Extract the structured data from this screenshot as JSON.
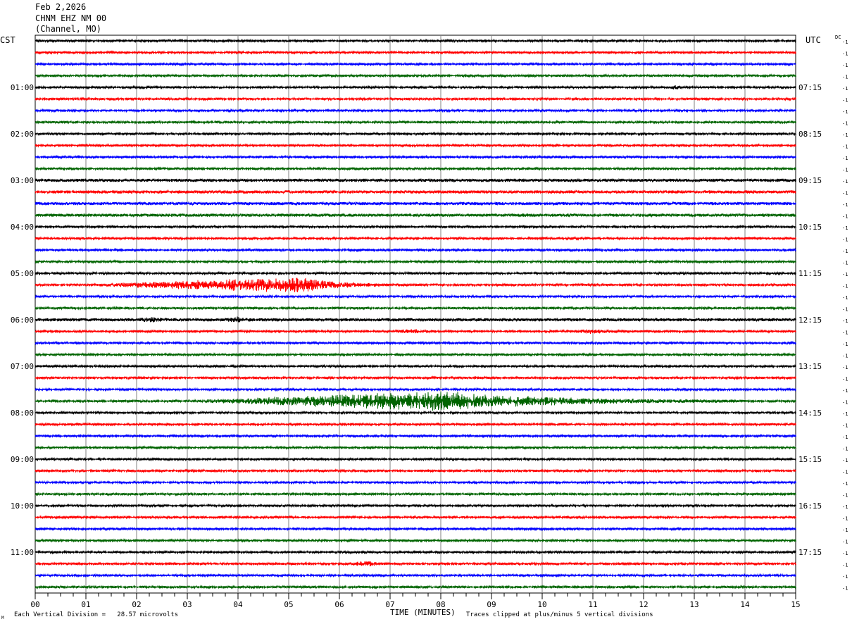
{
  "header": {
    "date": "Feb 2,2026",
    "station": "CHNM EHZ NM 00",
    "channel_note": "(Channel, MO)"
  },
  "left_tz": "CST",
  "right_tz": "UTC",
  "dc_label": "DC",
  "trace_offset_label": "-1",
  "footer": {
    "vertical_division": "Each Vertical Division =   28.57 microvolts",
    "x_title": "TIME (MINUTES)",
    "clip_note": "Traces clipped at plus/minus 5 vertical divisions",
    "corner_mark": "M"
  },
  "colors": {
    "black": "#000000",
    "red": "#ff0000",
    "blue": "#0000ff",
    "green": "#006400",
    "grid": "#808080"
  },
  "chart_data": {
    "type": "helicorder",
    "x_axis": {
      "label": "TIME (MINUTES)",
      "range": [
        0,
        15
      ],
      "ticks": [
        "00",
        "01",
        "02",
        "03",
        "04",
        "05",
        "06",
        "07",
        "08",
        "09",
        "10",
        "11",
        "12",
        "13",
        "14",
        "15"
      ]
    },
    "rows_per_hour": 4,
    "minutes_per_row": 15,
    "row_count": 48,
    "row_color_cycle": [
      "black",
      "red",
      "blue",
      "green"
    ],
    "left_hour_labels": [
      {
        "row": 4,
        "text": "01:00"
      },
      {
        "row": 8,
        "text": "02:00"
      },
      {
        "row": 12,
        "text": "03:00"
      },
      {
        "row": 16,
        "text": "04:00"
      },
      {
        "row": 20,
        "text": "05:00"
      },
      {
        "row": 24,
        "text": "06:00"
      },
      {
        "row": 28,
        "text": "07:00"
      },
      {
        "row": 32,
        "text": "08:00"
      },
      {
        "row": 36,
        "text": "09:00"
      },
      {
        "row": 40,
        "text": "10:00"
      },
      {
        "row": 44,
        "text": "11:00"
      }
    ],
    "right_hour_labels": [
      {
        "row": 4,
        "text": "07:15"
      },
      {
        "row": 8,
        "text": "08:15"
      },
      {
        "row": 12,
        "text": "09:15"
      },
      {
        "row": 16,
        "text": "10:15"
      },
      {
        "row": 20,
        "text": "11:15"
      },
      {
        "row": 24,
        "text": "12:15"
      },
      {
        "row": 28,
        "text": "13:15"
      },
      {
        "row": 32,
        "text": "14:15"
      },
      {
        "row": 36,
        "text": "15:15"
      },
      {
        "row": 40,
        "text": "16:15"
      },
      {
        "row": 44,
        "text": "17:15"
      }
    ],
    "noise_level": 1.5,
    "busy_rows": [
      12,
      13,
      14,
      15,
      24
    ],
    "events": [
      {
        "row": 21,
        "start_min": 1.0,
        "peak_min": 5.3,
        "end_min": 7.2,
        "amplitude": 11
      },
      {
        "row": 31,
        "start_min": 3.0,
        "peak_min": 8.0,
        "end_min": 14.0,
        "amplitude": 14
      },
      {
        "row": 45,
        "start_min": 6.0,
        "peak_min": 6.6,
        "end_min": 7.0,
        "amplitude": 3
      },
      {
        "row": 25,
        "start_min": 7.0,
        "peak_min": 7.5,
        "end_min": 8.0,
        "amplitude": 2.5
      },
      {
        "row": 25,
        "start_min": 10.6,
        "peak_min": 10.9,
        "end_min": 12.0,
        "amplitude": 2.5
      },
      {
        "row": 24,
        "start_min": 2.0,
        "peak_min": 2.4,
        "end_min": 2.6,
        "amplitude": 2.5
      },
      {
        "row": 24,
        "start_min": 3.7,
        "peak_min": 4.0,
        "end_min": 4.3,
        "amplitude": 2.5
      },
      {
        "row": 4,
        "start_min": 12.5,
        "peak_min": 12.65,
        "end_min": 12.8,
        "amplitude": 3
      }
    ]
  }
}
